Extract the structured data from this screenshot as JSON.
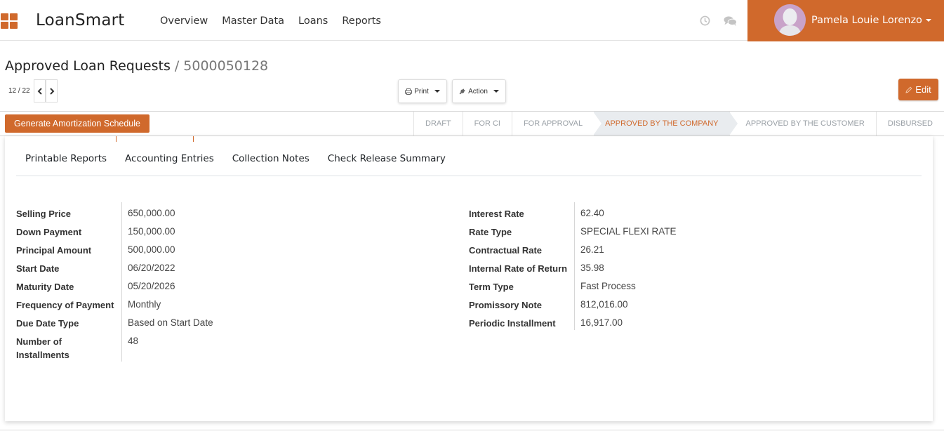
{
  "app": {
    "brand": "LoanSmart",
    "menu": [
      "Overview",
      "Master Data",
      "Loans",
      "Reports"
    ],
    "user_name": "Pamela Louie Lorenzo",
    "accent_color": "#d0692c"
  },
  "breadcrumb": {
    "root": "Approved Loan Requests",
    "separator": "/",
    "current": "5000050128"
  },
  "pager": {
    "value": "12 / 22"
  },
  "toolbar": {
    "print_label": "Print",
    "action_label": "Action",
    "edit_label": "Edit"
  },
  "statusbar": {
    "button_label": "Generate Amortization Schedule",
    "stages": [
      "DRAFT",
      "FOR CI",
      "FOR APPROVAL",
      "APPROVED BY THE COMPANY",
      "APPROVED BY THE CUSTOMER",
      "DISBURSED"
    ],
    "active_stage": "APPROVED BY THE COMPANY"
  },
  "tabs": [
    "Printable Reports",
    "Accounting Entries",
    "Collection Notes",
    "Check Release Summary"
  ],
  "left_fields": [
    {
      "label": "Selling Price",
      "value": "650,000.00"
    },
    {
      "label": "Down Payment",
      "value": "150,000.00"
    },
    {
      "label": "Principal Amount",
      "value": "500,000.00"
    },
    {
      "label": "Start Date",
      "value": "06/20/2022"
    },
    {
      "label": "Maturity Date",
      "value": "05/20/2026"
    },
    {
      "label": "Frequency of Payment",
      "value": "Monthly"
    },
    {
      "label": "Due Date Type",
      "value": "Based on Start Date"
    },
    {
      "label": "Number of Installments",
      "value": "48"
    }
  ],
  "right_fields": [
    {
      "label": "Interest Rate",
      "value": "62.40"
    },
    {
      "label": "Rate Type",
      "value": "SPECIAL FLEXI RATE"
    },
    {
      "label": "Contractual Rate",
      "value": "26.21"
    },
    {
      "label": "Internal Rate of Return",
      "value": "35.98"
    },
    {
      "label": "Term Type",
      "value": "Fast Process"
    },
    {
      "label": "Promissory Note",
      "value": "812,016.00"
    },
    {
      "label": "Periodic Installment",
      "value": "16,917.00"
    }
  ],
  "icons": {
    "apps": "apps-grid-icon",
    "clock": "clock-icon",
    "chat": "chat-icon",
    "printer": "printer-icon",
    "wrench": "wrench-icon",
    "pencil": "pencil-icon",
    "prev": "chevron-left-icon",
    "next": "chevron-right-icon"
  }
}
